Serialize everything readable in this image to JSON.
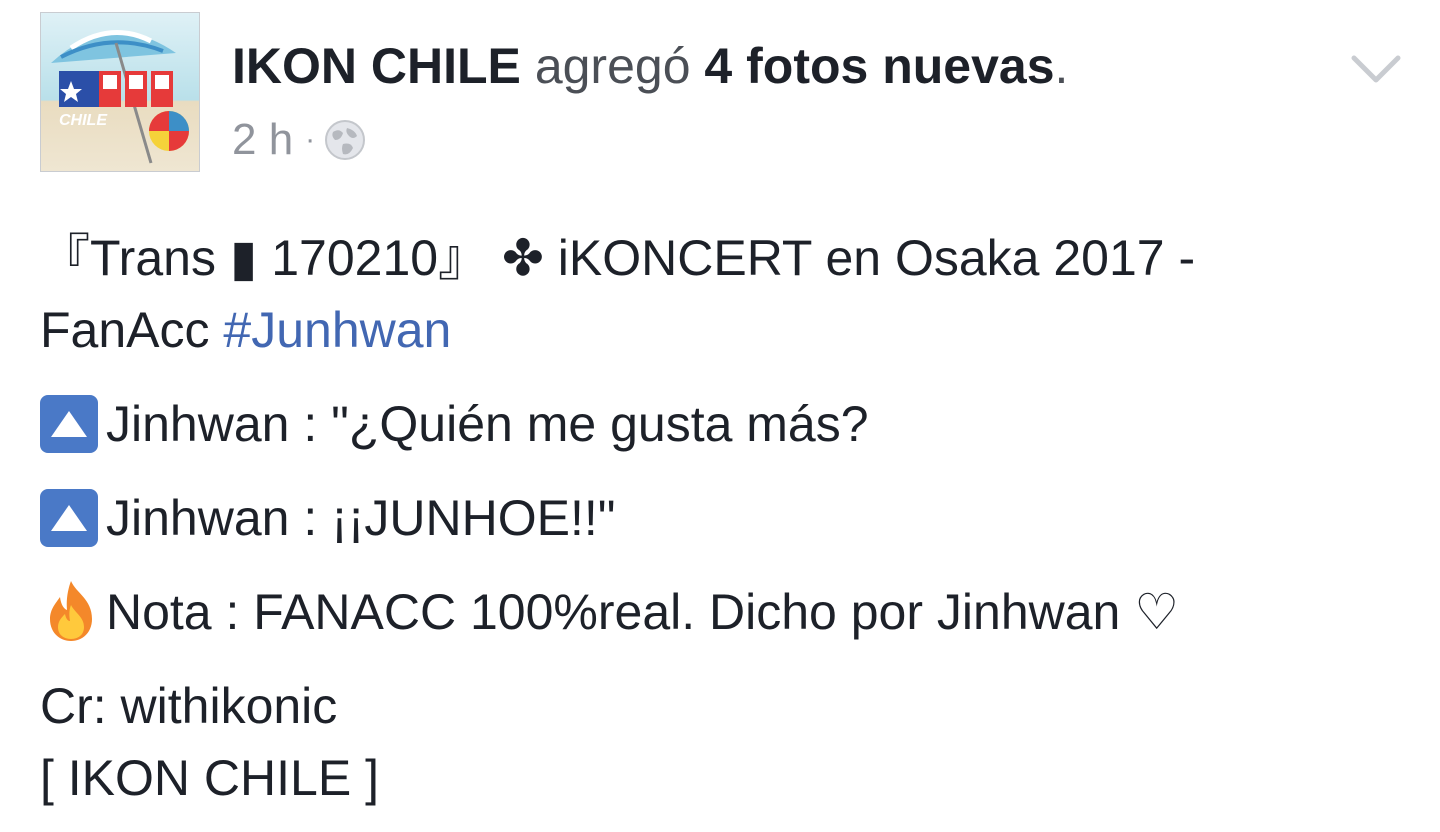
{
  "post": {
    "author": "IKON CHILE",
    "action_text": "agregó",
    "photos_text": "4 fotos nuevas",
    "period": ".",
    "timestamp": "2 h",
    "separator": "·",
    "privacy_icon": "globe-icon",
    "menu_icon": "chevron-down-icon",
    "avatar_logo_text": "CHILE",
    "lines": {
      "title_part1": " 『Trans ▮ 170210』 ",
      "club_symbol": "✤",
      "title_part2": " iKONCERT en Osaka 2017 -",
      "fanacc": "FanAcc ",
      "hashtag": "#Junhwan",
      "quote1": "Jinhwan : \"¿Quién me gusta más?",
      "quote2": "Jinhwan : ¡¡JUNHOE!!\"",
      "note": "Nota : FANACC 100%real. Dicho por Jinhwan ♡",
      "credit": "Cr: withikonic",
      "signature": "[ IKON CHILE ]"
    }
  },
  "colors": {
    "link": "#4267b2",
    "up_icon": "#4a79c7",
    "meta": "#90949c"
  }
}
